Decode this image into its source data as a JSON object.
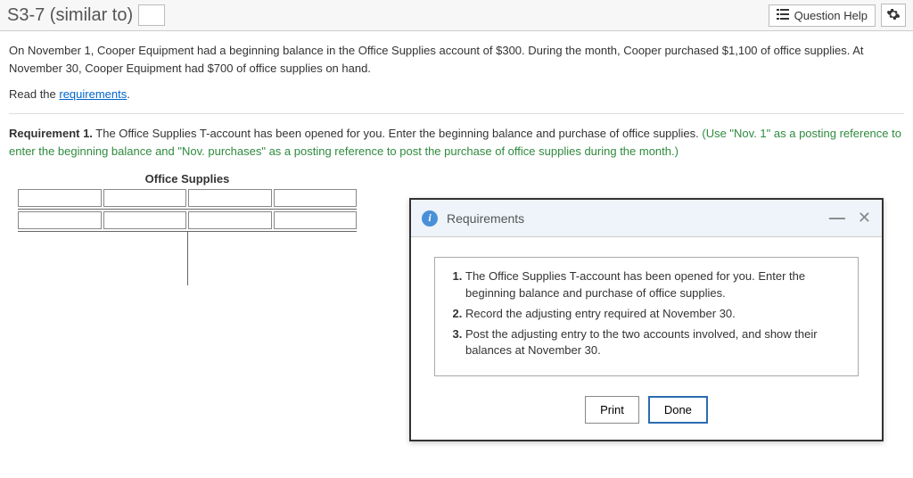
{
  "header": {
    "title": "S3-7 (similar to)",
    "help_label": "Question Help"
  },
  "problem": {
    "text": "On November 1, Cooper Equipment had a beginning balance in the Office Supplies account of $300. During the month, Cooper purchased $1,100 of office supplies. At November 30, Cooper Equipment had $700 of office supplies on hand.",
    "read_prefix": "Read the ",
    "read_link": "requirements",
    "read_suffix": "."
  },
  "requirement1": {
    "bold": "Requirement 1.",
    "text": " The Office Supplies T-account has been opened for you. Enter the beginning balance and purchase of office supplies. ",
    "hint": "(Use \"Nov. 1\" as a posting reference to enter the beginning balance and \"Nov. purchases\" as a posting reference to post the purchase of office supplies during the month.)"
  },
  "t_account": {
    "title": "Office Supplies"
  },
  "popup": {
    "title": "Requirements",
    "items": [
      "The Office Supplies T-account has been opened for you. Enter the beginning balance and purchase of office supplies.",
      "Record the adjusting entry required at November 30.",
      "Post the adjusting entry to the two accounts involved, and show their balances at November 30."
    ],
    "print_label": "Print",
    "done_label": "Done"
  }
}
